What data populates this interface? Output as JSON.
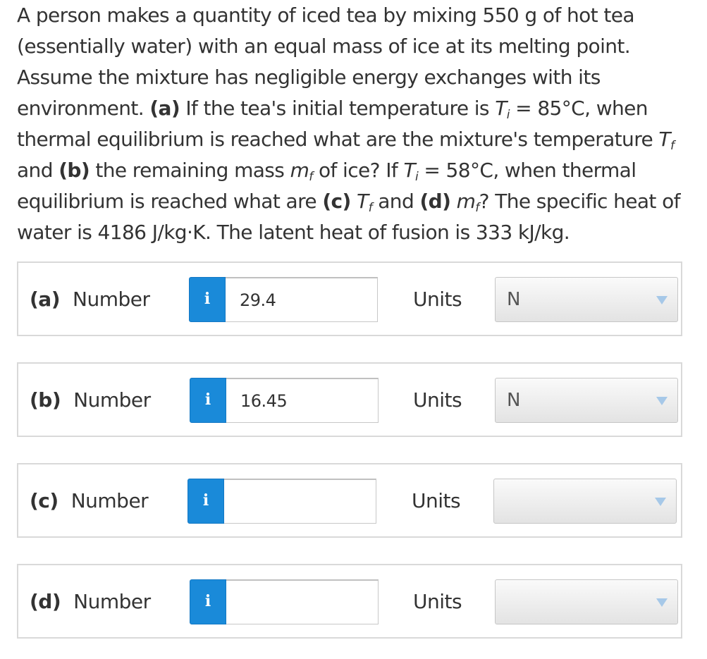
{
  "question": {
    "s1": "A person makes a quantity of iced tea by mixing 550 g of hot tea (essentially water) with an equal mass of ice at its melting point. Assume the mixture has negligible energy exchanges with its environment. ",
    "a_tag": "(a)",
    "s2": " If the tea's initial temperature is ",
    "T": "T",
    "sub_i": "i",
    "s3": " = 85°C, when thermal equilibrium is reached what are the mixture's temperature ",
    "sub_f": "f",
    "s4": " and ",
    "b_tag": "(b)",
    "s5": " the remaining mass ",
    "m": "m",
    "s6": " of ice? If ",
    "s7": " = 58°C, when thermal equilibrium is reached what are ",
    "c_tag": "(c)",
    "s8": " and ",
    "d_tag": "(d)",
    "s9": "? The specific heat of water is 4186 J/kg·K. The latent heat of fusion is 333 kJ/kg."
  },
  "parts": [
    {
      "letter": "(a)",
      "label": "Number",
      "info_icon": "i",
      "value": "29.4",
      "units_label": "Units",
      "units_value": "N"
    },
    {
      "letter": "(b)",
      "label": "Number",
      "info_icon": "i",
      "value": "16.45",
      "units_label": "Units",
      "units_value": "N"
    },
    {
      "letter": "(c)",
      "label": "Number",
      "info_icon": "i",
      "value": "",
      "units_label": "Units",
      "units_value": ""
    },
    {
      "letter": "(d)",
      "label": "Number",
      "info_icon": "i",
      "value": "",
      "units_label": "Units",
      "units_value": ""
    }
  ],
  "colors": {
    "info_button": "#1a8ad9",
    "border": "#d9d9d9",
    "dropdown_arrow": "#a6c8e8"
  },
  "icons": {
    "info": "info-icon",
    "dropdown": "chevron-down-icon"
  }
}
